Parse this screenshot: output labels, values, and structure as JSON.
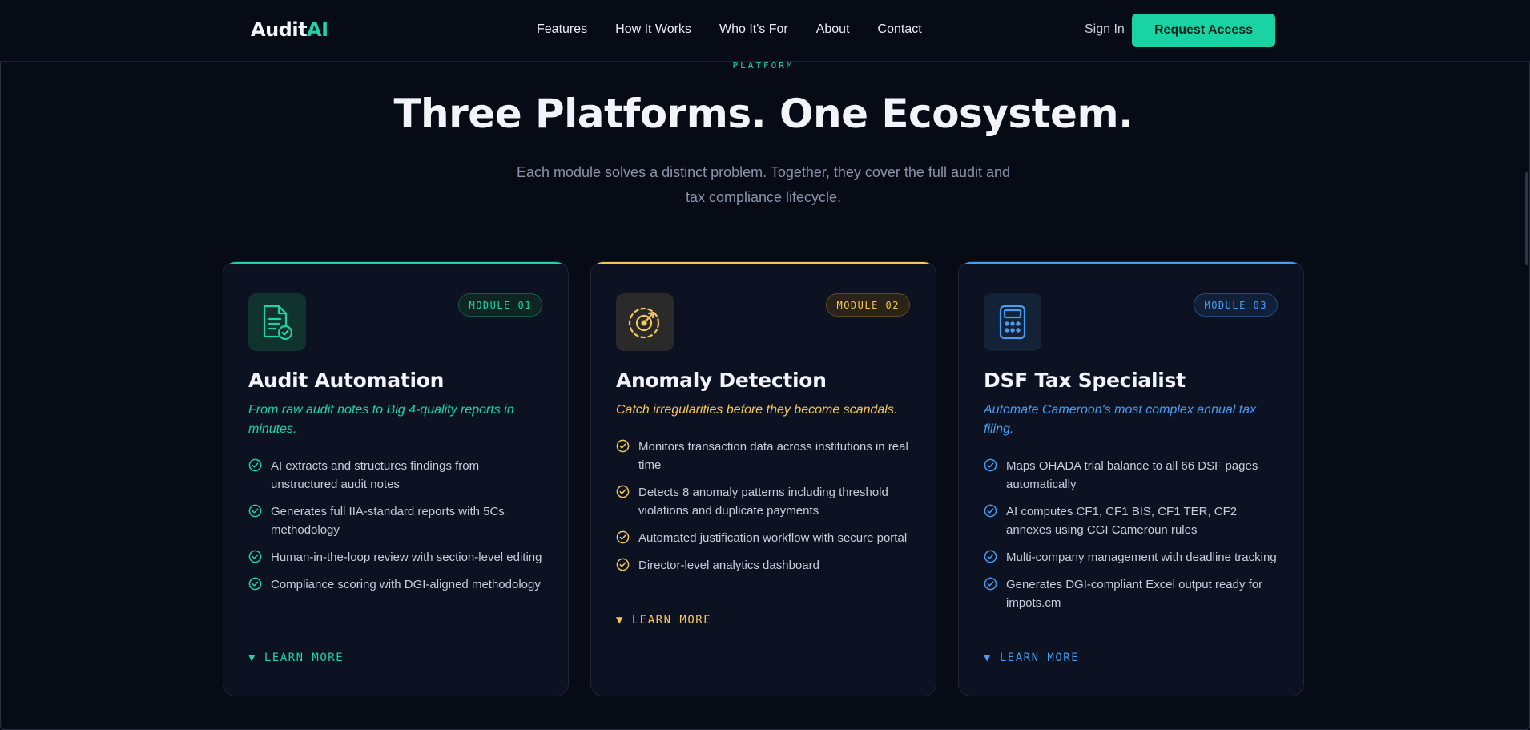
{
  "nav": {
    "logo_main": "Audit",
    "logo_accent": "AI",
    "links": [
      "Features",
      "How It Works",
      "Who It's For",
      "About",
      "Contact"
    ],
    "sign_in": "Sign In",
    "cta": "Request Access"
  },
  "hero": {
    "eyebrow": "PLATFORM",
    "title": "Three Platforms. One Ecosystem.",
    "subtitle": "Each module solves a distinct problem. Together, they cover the full audit and tax compliance lifecycle."
  },
  "colors": {
    "teal": "#1ed3a6",
    "gold": "#f5c65b",
    "blue": "#4a9cf0",
    "background": "#070b16",
    "card": "#0c1222"
  },
  "cards": [
    {
      "icon": "document-check-icon",
      "module": "MODULE 01",
      "title": "Audit Automation",
      "tagline": "From raw audit notes to Big 4-quality reports in minutes.",
      "features": [
        "AI extracts and structures findings from unstructured audit notes",
        "Generates full IIA-standard reports with 5Cs methodology",
        "Human-in-the-loop review with section-level editing",
        "Compliance scoring with DGI-aligned methodology"
      ],
      "learn_more": "▼ LEARN MORE"
    },
    {
      "icon": "radar-target-icon",
      "module": "MODULE 02",
      "title": "Anomaly Detection",
      "tagline": "Catch irregularities before they become scandals.",
      "features": [
        "Monitors transaction data across institutions in real time",
        "Detects 8 anomaly patterns including threshold violations and duplicate payments",
        "Automated justification workflow with secure portal",
        "Director-level analytics dashboard"
      ],
      "learn_more": "▼ LEARN MORE"
    },
    {
      "icon": "calculator-icon",
      "module": "MODULE 03",
      "title": "DSF Tax Specialist",
      "tagline": "Automate Cameroon's most complex annual tax filing.",
      "features": [
        "Maps OHADA trial balance to all 66 DSF pages automatically",
        "AI computes CF1, CF1 BIS, CF1 TER, CF2 annexes using CGI Cameroun rules",
        "Multi-company management with deadline tracking",
        "Generates DGI-compliant Excel output ready for impots.cm"
      ],
      "learn_more": "▼ LEARN MORE"
    }
  ]
}
